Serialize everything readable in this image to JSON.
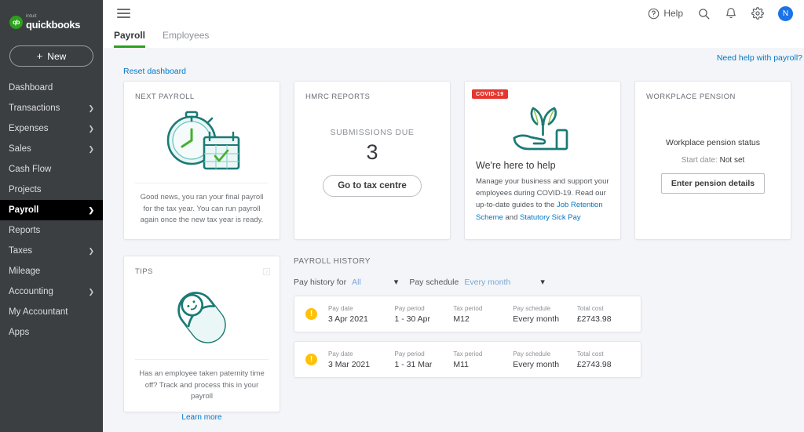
{
  "brand": {
    "intuit": "intuit",
    "name": "quickbooks",
    "logo_mark": "qb"
  },
  "sidebar": {
    "new_button": "New",
    "new_icon": "plus-icon",
    "items": [
      {
        "label": "Dashboard",
        "chevron": false,
        "active": false
      },
      {
        "label": "Transactions",
        "chevron": true,
        "active": false
      },
      {
        "label": "Expenses",
        "chevron": true,
        "active": false
      },
      {
        "label": "Sales",
        "chevron": true,
        "active": false
      },
      {
        "label": "Cash Flow",
        "chevron": false,
        "active": false
      },
      {
        "label": "Projects",
        "chevron": false,
        "active": false
      },
      {
        "label": "Payroll",
        "chevron": true,
        "active": true
      },
      {
        "label": "Reports",
        "chevron": false,
        "active": false
      },
      {
        "label": "Taxes",
        "chevron": true,
        "active": false
      },
      {
        "label": "Mileage",
        "chevron": false,
        "active": false
      },
      {
        "label": "Accounting",
        "chevron": true,
        "active": false
      },
      {
        "label": "My Accountant",
        "chevron": false,
        "active": false
      },
      {
        "label": "Apps",
        "chevron": false,
        "active": false
      }
    ]
  },
  "topbar": {
    "menu_icon": "hamburger-icon",
    "help_label": "Help",
    "help_icon": "question-circle-icon",
    "search_icon": "search-icon",
    "notifications_icon": "bell-icon",
    "settings_icon": "gear-icon",
    "avatar_initial": "N"
  },
  "tabs": [
    {
      "label": "Payroll",
      "active": true
    },
    {
      "label": "Employees",
      "active": false
    }
  ],
  "links": {
    "need_help": "Need help with payroll?",
    "reset_dashboard": "Reset dashboard"
  },
  "cards": {
    "next_payroll": {
      "title": "NEXT PAYROLL",
      "art": "stopwatch-calendar-illustration",
      "footer": "Good news, you ran your final payroll for the tax year. You can run payroll again once the new tax year is ready."
    },
    "hmrc": {
      "title": "HMRC REPORTS",
      "submissions_label": "SUBMISSIONS DUE",
      "submissions_count": "3",
      "button": "Go to tax centre"
    },
    "covid": {
      "title": "",
      "badge": "COVID-19",
      "art": "hand-plant-illustration",
      "heading": "We're here to help",
      "body_1": "Manage your business and support your employees during COVID-19. Read our up-to-date guides to the ",
      "link_1": "Job Retention Scheme",
      "body_2": " and ",
      "link_2": "Statutory Sick Pay"
    },
    "pension": {
      "title": "WORKPLACE PENSION",
      "status_label": "Workplace pension status",
      "start_date_label": "Start date:",
      "start_date_value": "Not set",
      "button": "Enter pension details"
    },
    "tips": {
      "title": "TIPS",
      "corner_icon": "next-tip-icon",
      "art": "swaddled-baby-illustration",
      "body": "Has an employee taken paternity time off? Track and process this in your payroll",
      "link": "Learn more"
    }
  },
  "payroll_history": {
    "title": "PAYROLL HISTORY",
    "filters": [
      {
        "label": "Pay history for",
        "value": "All",
        "chevron_icon": "chevron-down-icon"
      },
      {
        "label": "Pay schedule",
        "value": "Every month",
        "chevron_icon": "chevron-down-icon"
      }
    ],
    "columns": [
      "Pay date",
      "Pay period",
      "Tax period",
      "Pay schedule",
      "Total cost"
    ],
    "rows": [
      {
        "status_icon": "warning-icon",
        "pay_date": "3 Apr 2021",
        "pay_period": "1 - 30 Apr",
        "tax_period": "M12",
        "pay_schedule": "Every month",
        "total_cost": "£2743.98"
      },
      {
        "status_icon": "warning-icon",
        "pay_date": "3 Mar 2021",
        "pay_period": "1 - 31 Mar",
        "tax_period": "M11",
        "pay_schedule": "Every month",
        "total_cost": "£2743.98"
      }
    ]
  },
  "colors": {
    "brand_green": "#2ca01c",
    "link_blue": "#0077c5",
    "sidebar_bg": "#3c3f42",
    "teal": "#1b7a76",
    "covid_red": "#e4372f",
    "warning_yellow": "#ffc107",
    "avatar_blue": "#1a73e8"
  }
}
